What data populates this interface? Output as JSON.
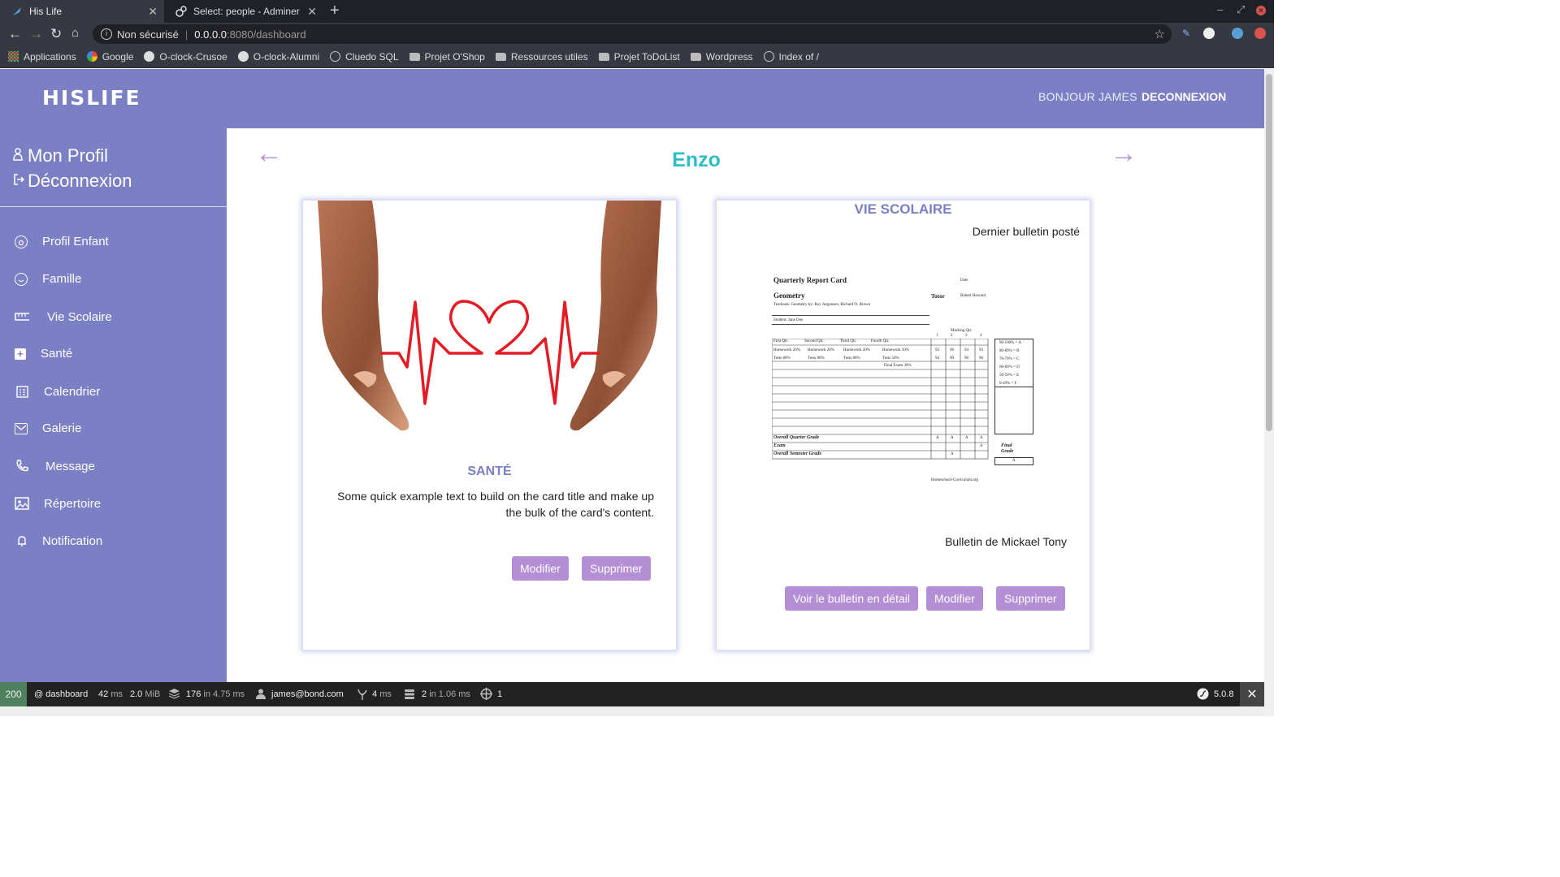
{
  "browser": {
    "tabs": [
      {
        "title": "His Life",
        "active": true
      },
      {
        "title": "Select: people - Adminer",
        "active": false
      }
    ],
    "security_label": "Non sécurisé",
    "url_host": "0.0.0.0",
    "url_path": ":8080/dashboard",
    "bookmarks": [
      "Applications",
      "Google",
      "O-clock-Crusoe",
      "O-clock-Alumni",
      "Cluedo SQL",
      "Projet O'Shop",
      "Ressources utiles",
      "Projet ToDoList",
      "Wordpress",
      "Index of /"
    ],
    "bookmark_icons": [
      "apps-icon",
      "google-icon",
      "github-icon",
      "github-icon",
      "globe-icon",
      "folder-icon",
      "folder-icon",
      "folder-icon",
      "folder-icon",
      "globe-icon"
    ]
  },
  "header": {
    "logo": "HISLIFE",
    "greeting": "BONJOUR JAMES",
    "logout": "DECONNEXION"
  },
  "sidebar": {
    "profile": "Mon Profil",
    "logout": "Déconnexion",
    "items": [
      {
        "label": "Profil Enfant",
        "icon": "baby-face-icon"
      },
      {
        "label": "Famille",
        "icon": "smile-icon"
      },
      {
        "label": "Vie Scolaire",
        "icon": "ruler-icon"
      },
      {
        "label": "Santé",
        "icon": "medical-plus-icon"
      },
      {
        "label": "Calendrier",
        "icon": "calendar-icon"
      },
      {
        "label": "Galerie",
        "icon": "envelope-icon"
      },
      {
        "label": "Message",
        "icon": "phone-icon"
      },
      {
        "label": "Répertoire",
        "icon": "image-icon"
      },
      {
        "label": "Notification",
        "icon": "bell-icon"
      }
    ]
  },
  "main": {
    "child_name": "Enzo",
    "prev_arrow": "←",
    "next_arrow": "→",
    "health_card": {
      "title": "SANTÉ",
      "text": "Some quick example text to build on the card title and make up the bulk of the card's content.",
      "edit_label": "Modifier",
      "delete_label": "Supprimer"
    },
    "school_card": {
      "title": "VIE SCOLAIRE",
      "subtitle": "Dernier bulletin posté",
      "caption": "Bulletin de Mickael Tony",
      "view_label": "Voir le bulletin en détail",
      "edit_label": "Modifier",
      "delete_label": "Supprimer",
      "report": {
        "heading": "Quarterly Report Card",
        "date_label": "Date",
        "subject": "Geometry",
        "tutor_label": "Tutor",
        "tutor": "Robert Howard",
        "textbook": "Textbook: Geometry by: Roy Jurgensen, Richard O. Brown",
        "student": "Student: Jane Doe",
        "marking_qtr": "Marking Qtr.",
        "quarters": [
          "First Qtr.",
          "Second Qtr.",
          "Third Qtr.",
          "Fourth Qtr."
        ],
        "q_numbers": [
          "1",
          "2",
          "3",
          "4"
        ],
        "row1": [
          "Homework 20%",
          "Homework 20%",
          "Homework 20%",
          "Homework 10%"
        ],
        "row1_scores": [
          "92",
          "96",
          "94",
          "93"
        ],
        "row2": [
          "Tests 80%",
          "Tests 80%",
          "Tests 80%",
          "Tests 50%"
        ],
        "row2_scores": [
          "94",
          "90",
          "90",
          "96"
        ],
        "final_exam": "Final Exam 30%",
        "scale": [
          "90-100% = A",
          "80-89% = B",
          "70-79% = C",
          "60-69% = D",
          "50-59% = E",
          "0-49% = F"
        ],
        "overall_quarter": "Overall Quarter Grade",
        "exam": "Exam",
        "overall_semester": "Overall Semester Grade",
        "final_grade": "Final Grade",
        "grade": "A",
        "footer": "Homeschool-Curriculum.org"
      }
    }
  },
  "profiler": {
    "status": "200",
    "route": "@ dashboard",
    "time": "42",
    "time_unit": "ms",
    "memory": "2.0",
    "memory_unit": "MiB",
    "events": "176",
    "events_in": "in 4.75 ms",
    "user": "james@bond.com",
    "twig_time": "4",
    "twig_unit": "ms",
    "db": "2",
    "db_in": "in 1.06 ms",
    "forms": "1",
    "version": "5.0.8"
  }
}
